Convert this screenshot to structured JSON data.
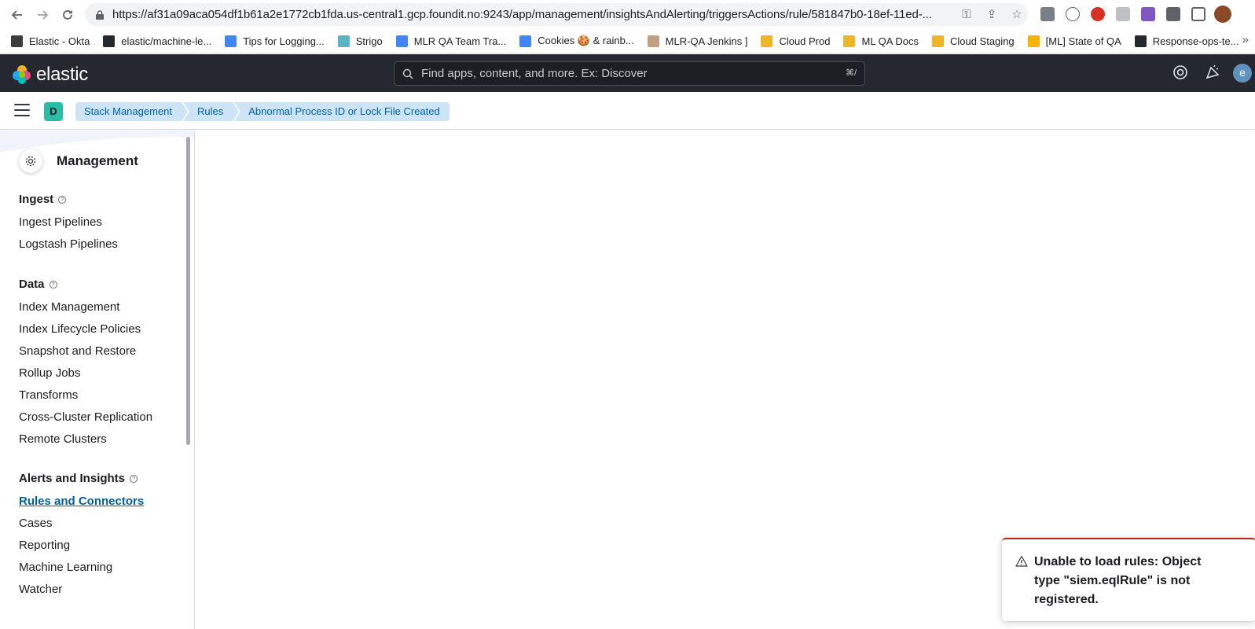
{
  "browser": {
    "url": "https://af31a09aca054df1b61a2e1772cb1fda.us-central1.gcp.foundit.no:9243/app/management/insightsAndAlerting/triggersActions/rule/581847b0-18ef-11ed-...",
    "bookmarks": [
      {
        "label": "Elastic - Okta",
        "color": "#3c3c3c"
      },
      {
        "label": "elastic/machine-le...",
        "color": "#24292f"
      },
      {
        "label": "Tips for Logging...",
        "color": "#4285f4"
      },
      {
        "label": "Strigo",
        "color": "#5ab4c4"
      },
      {
        "label": "MLR QA Team Tra...",
        "color": "#4285f4"
      },
      {
        "label": "Cookies 🍪 & rainb...",
        "color": "#4285f4"
      },
      {
        "label": "MLR-QA Jenkins ]",
        "color": "#c0a080"
      },
      {
        "label": "Cloud Prod",
        "color": "#f0b429"
      },
      {
        "label": "ML QA Docs",
        "color": "#f0b429"
      },
      {
        "label": "Cloud Staging",
        "color": "#f0b429"
      },
      {
        "label": "[ML] State of QA",
        "color": "#f4b400"
      },
      {
        "label": "Response-ops-te...",
        "color": "#24292f"
      }
    ],
    "more": "»"
  },
  "header": {
    "logo_text": "elastic",
    "search_placeholder": "Find apps, content, and more. Ex: Discover",
    "search_shortcut": "⌘/",
    "avatar": "e"
  },
  "breadcrumbs": {
    "space": "D",
    "items": [
      "Stack Management",
      "Rules",
      "Abnormal Process ID or Lock File Created"
    ]
  },
  "sidebar": {
    "title": "Management",
    "sections": {
      "ingest": {
        "title": "Ingest",
        "items": [
          "Ingest Pipelines",
          "Logstash Pipelines"
        ]
      },
      "data": {
        "title": "Data",
        "items": [
          "Index Management",
          "Index Lifecycle Policies",
          "Snapshot and Restore",
          "Rollup Jobs",
          "Transforms",
          "Cross-Cluster Replication",
          "Remote Clusters"
        ]
      },
      "alerts": {
        "title": "Alerts and Insights",
        "items": [
          "Rules and Connectors",
          "Cases",
          "Reporting",
          "Machine Learning",
          "Watcher"
        ]
      }
    }
  },
  "toast": {
    "message": "Unable to load rules: Object type \"siem.eqlRule\" is not registered."
  },
  "colors": {
    "header_bg": "#25282f",
    "breadcrumb_bg": "#cce4f5",
    "link": "#0061a6",
    "danger": "#bd271e",
    "space_badge": "#2bbca7"
  }
}
